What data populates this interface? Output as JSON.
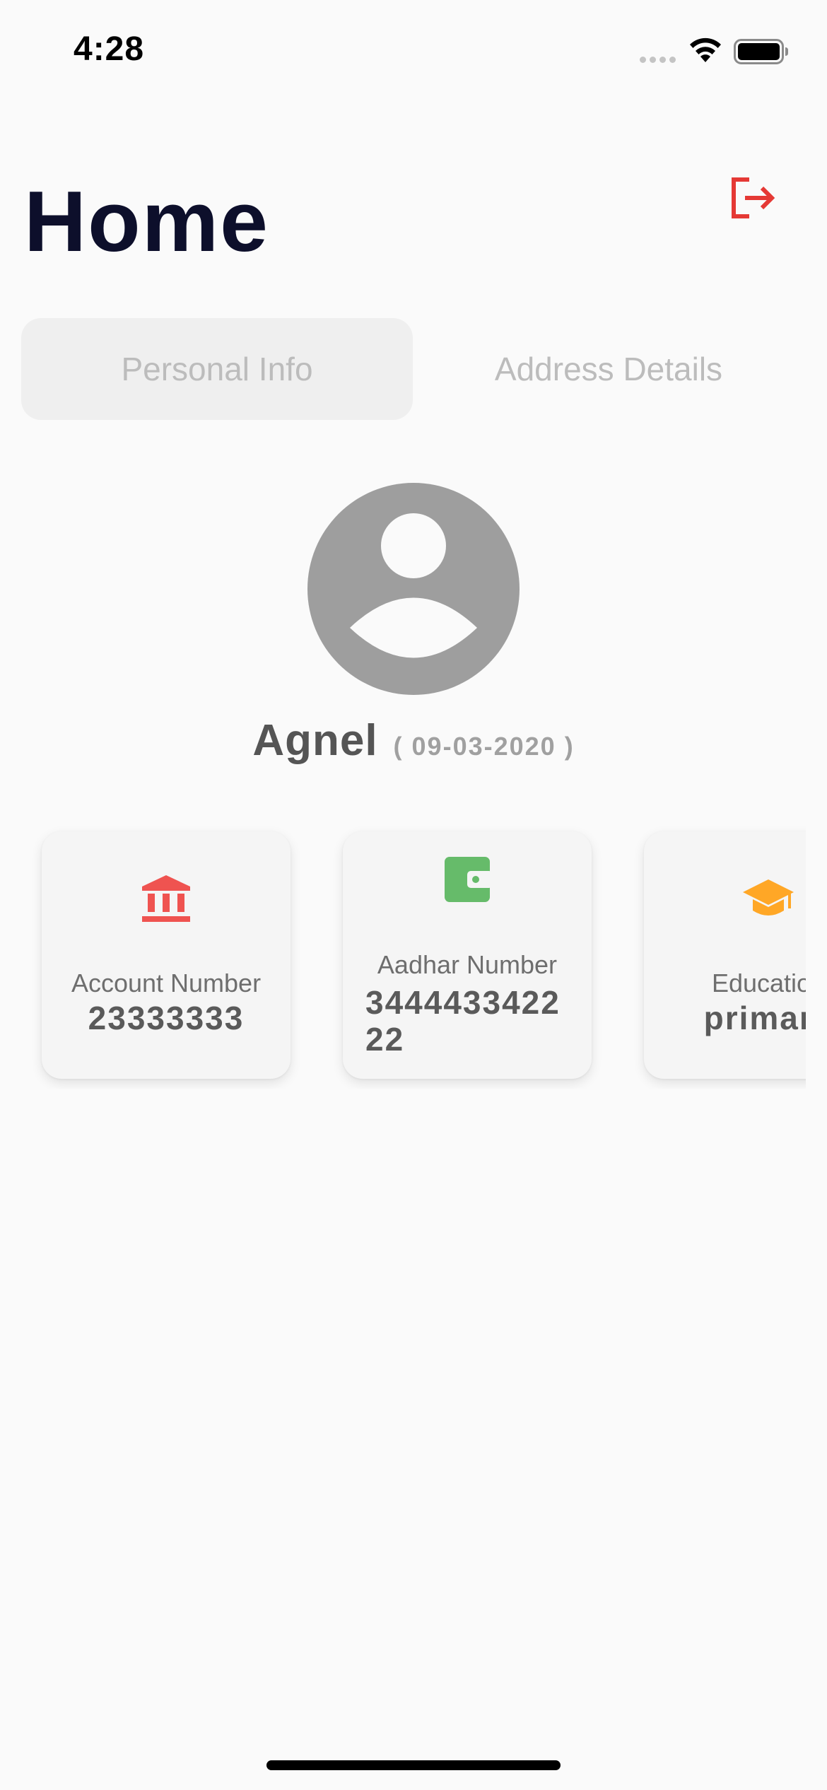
{
  "status_bar": {
    "time": "4:28"
  },
  "header": {
    "title": "Home",
    "logout_icon": "logout-icon"
  },
  "tabs": [
    {
      "label": "Personal Info",
      "selected": true
    },
    {
      "label": "Address Details",
      "selected": false
    }
  ],
  "profile": {
    "name": "Agnel",
    "dob": "( 09-03-2020 )",
    "avatar_icon": "person-avatar-icon"
  },
  "cards": [
    {
      "label": "Account Number",
      "value": "23333333",
      "icon": "bank-icon",
      "color": "#ef5350"
    },
    {
      "label": "Aadhar Number",
      "value": "344443342222",
      "icon": "wallet-icon",
      "color": "#66bb6a"
    },
    {
      "label": "Education",
      "value": "primary",
      "icon": "graduation-cap-icon",
      "color": "#ffa726"
    }
  ],
  "colors": {
    "title": "#0d0f2b",
    "logout": "#e53935",
    "tab_selected_bg": "#efefef",
    "tab_text": "#bcbcbc",
    "avatar": "#9e9e9e"
  }
}
